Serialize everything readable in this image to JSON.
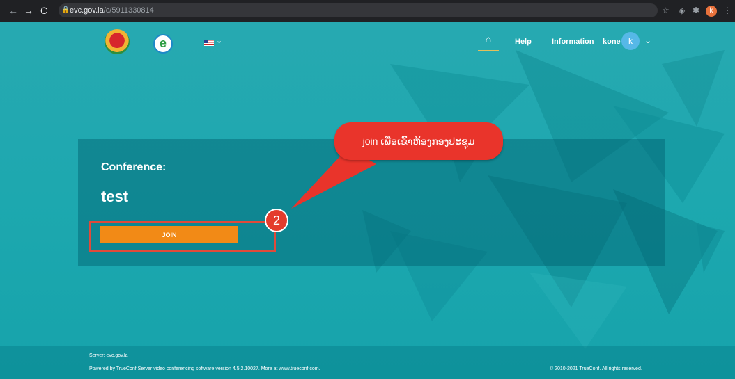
{
  "browser": {
    "url_host": "evc.gov.la",
    "url_path": "/c/5911330814",
    "profile_initial": "k"
  },
  "header": {
    "nav": [
      "Help",
      "Information"
    ],
    "user_name": "kone",
    "avatar_initial": "k"
  },
  "conference": {
    "label": "Conference:",
    "name": "test",
    "join_label": "JOIN"
  },
  "annotation": {
    "step_number": "2",
    "callout_text": "join ເພື່ອເຂົ້າຫ້ອງກອງປະຊຸມ"
  },
  "footer": {
    "server": "Server: evc.gov.la",
    "powered_prefix": "Powered by TrueConf Server",
    "powered_link": "video conferencing software",
    "powered_middle": "version 4.5.2.10027. More at",
    "powered_url": "www.trueconf.com",
    "powered_suffix": ".",
    "copyright": "© 2010-2021 TrueConf. All rights reserved."
  },
  "colors": {
    "accent_join": "#f28a16",
    "annotation_red": "#e43c2c",
    "background_teal": "#1aa7ae"
  },
  "icons": [
    "back-icon",
    "forward-icon",
    "reload-icon",
    "lock-icon",
    "star-icon",
    "extension-icon",
    "puzzle-icon",
    "menu-icon",
    "home-icon",
    "chevron-down-icon"
  ]
}
